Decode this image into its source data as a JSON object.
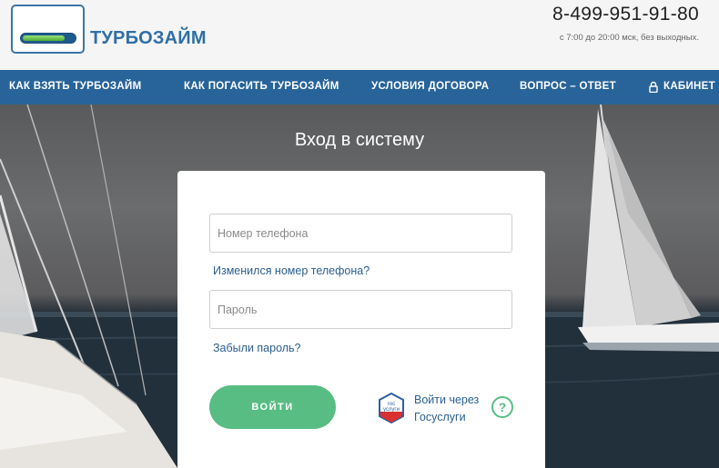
{
  "header": {
    "logo_text": "ТУРБОЗАЙМ",
    "phone": "8-499-951-91-80",
    "hours": "с 7:00 до 20:00 мск, без выходных."
  },
  "nav": {
    "items": [
      {
        "label": "КАК ВЗЯТЬ ТУРБОЗАЙМ"
      },
      {
        "label": "КАК ПОГАСИТЬ ТУРБОЗАЙМ"
      },
      {
        "label": "УСЛОВИЯ ДОГОВОРА"
      },
      {
        "label": "ВОПРОС – ОТВЕТ"
      },
      {
        "label": "КАБИНЕТ",
        "icon": "lock-icon"
      }
    ]
  },
  "login": {
    "title": "Вход в систему",
    "phone_field": {
      "placeholder": "Номер телефона",
      "value": ""
    },
    "phone_changed_link": "Изменился номер телефона?",
    "password_field": {
      "placeholder": "Пароль",
      "value": ""
    },
    "forgot_password_link": "Забыли пароль?",
    "submit_label": "ВОЙТИ",
    "gosuslugi": {
      "icon": "gosuslugi-icon",
      "icon_line1": "гос",
      "icon_line2": "услуги",
      "label_line1": "Войти через",
      "label_line2": "Госуслуги"
    },
    "help_icon": "?"
  },
  "colors": {
    "brand_blue": "#28649a",
    "logo_blue": "#2f6fa7",
    "accent_green": "#58bd83",
    "link_blue": "#2a5e8f"
  }
}
